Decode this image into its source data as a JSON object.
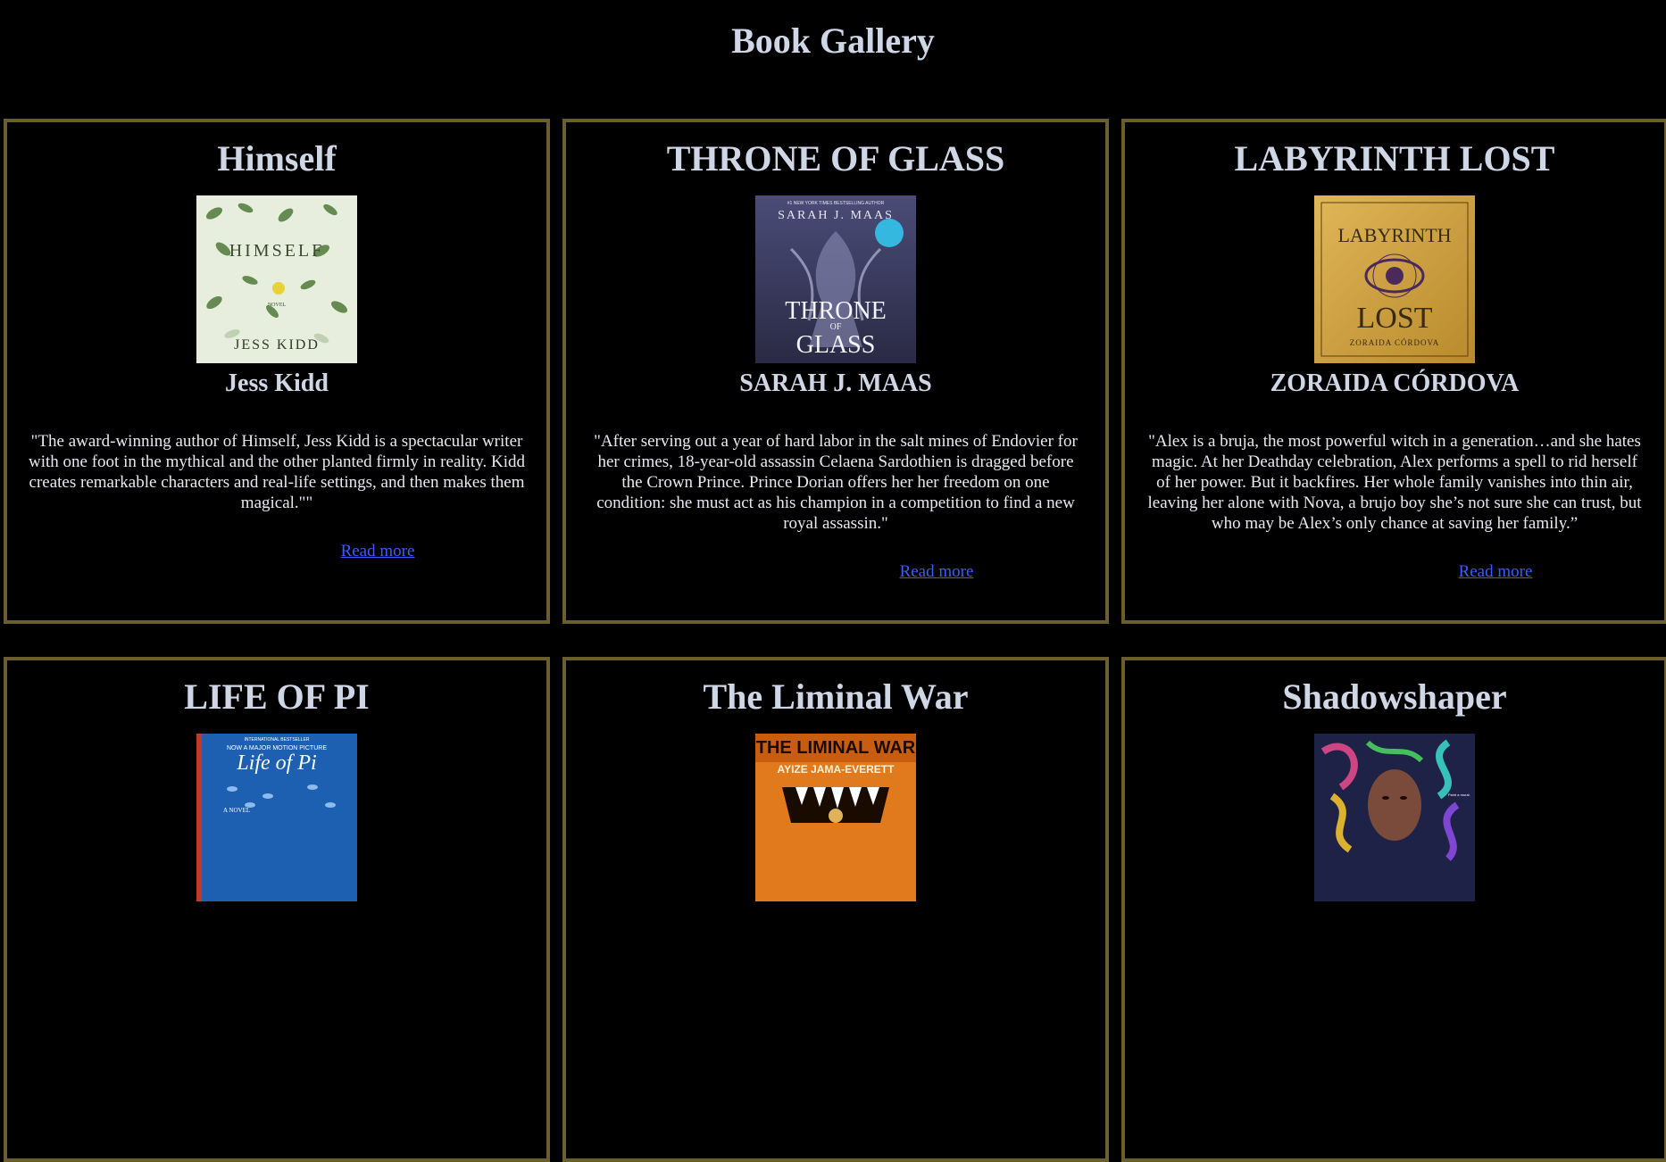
{
  "page": {
    "title": "Book Gallery"
  },
  "books": [
    {
      "title": "Himself",
      "author": "Jess Kidd",
      "description": "\"The award-winning author of Himself, Jess Kidd is a spectacular writer with one foot in the mythical and the other planted firmly in reality. Kidd creates remarkable characters and real-life settings, and then makes them magical.\"\"",
      "link_label": "Read more",
      "cover": {
        "title_text": "HIMSELF",
        "author_text": "JESS KIDD",
        "subtitle_text": "NOVEL",
        "bg": "#dfe8d2",
        "fg": "#3b4a2f"
      }
    },
    {
      "title": "THRONE OF GLASS",
      "author": "SARAH J. MAAS",
      "description": "\"After serving out a year of hard labor in the salt mines of Endovier for her crimes, 18-year-old assassin Celaena Sardothien is dragged before the Crown Prince. Prince Dorian offers her her freedom on one condition: she must act as his champion in a competition to find a new royal assassin.\"",
      "link_label": "Read more",
      "cover": {
        "title_text": "THRONE OF GLASS",
        "author_text": "SARAH J. MAAS",
        "subtitle_text": "",
        "bg": "#3b3d63",
        "fg": "#e4e6f2"
      }
    },
    {
      "title": "LABYRINTH LOST",
      "author": "ZORAIDA CÓRDOVA",
      "description": "\"Alex is a bruja, the most powerful witch in a generation…and she hates magic. At her Deathday celebration, Alex performs a spell to rid herself of her power. But it backfires. Her whole family vanishes into thin air, leaving her alone with Nova, a brujo boy she’s not sure she can trust, but who may be Alex’s only chance at saving her family.”",
      "link_label": "Read more",
      "cover": {
        "title_text": "LABYRINTH LOST",
        "author_text": "ZORAIDA CÓRDOVA",
        "subtitle_text": "",
        "bg": "#d2a443",
        "fg": "#3a2a10"
      }
    },
    {
      "title": "LIFE OF PI",
      "author": "",
      "description": "",
      "link_label": "",
      "cover": {
        "title_text": "Life of Pi",
        "author_text": "",
        "subtitle_text": "A NOVEL",
        "bg": "#1d5fb0",
        "fg": "#ffffff"
      }
    },
    {
      "title": "The Liminal War",
      "author": "",
      "description": "",
      "link_label": "",
      "cover": {
        "title_text": "THE LIMINAL WAR",
        "author_text": "AYIZE JAMA-EVERETT",
        "subtitle_text": "",
        "bg": "#e07a1d",
        "fg": "#1a0b00"
      }
    },
    {
      "title": "Shadowshaper",
      "author": "",
      "description": "",
      "link_label": "",
      "cover": {
        "title_text": "",
        "author_text": "",
        "subtitle_text": "",
        "bg": "#2a2f5a",
        "fg": "#f0e6e6"
      }
    }
  ]
}
